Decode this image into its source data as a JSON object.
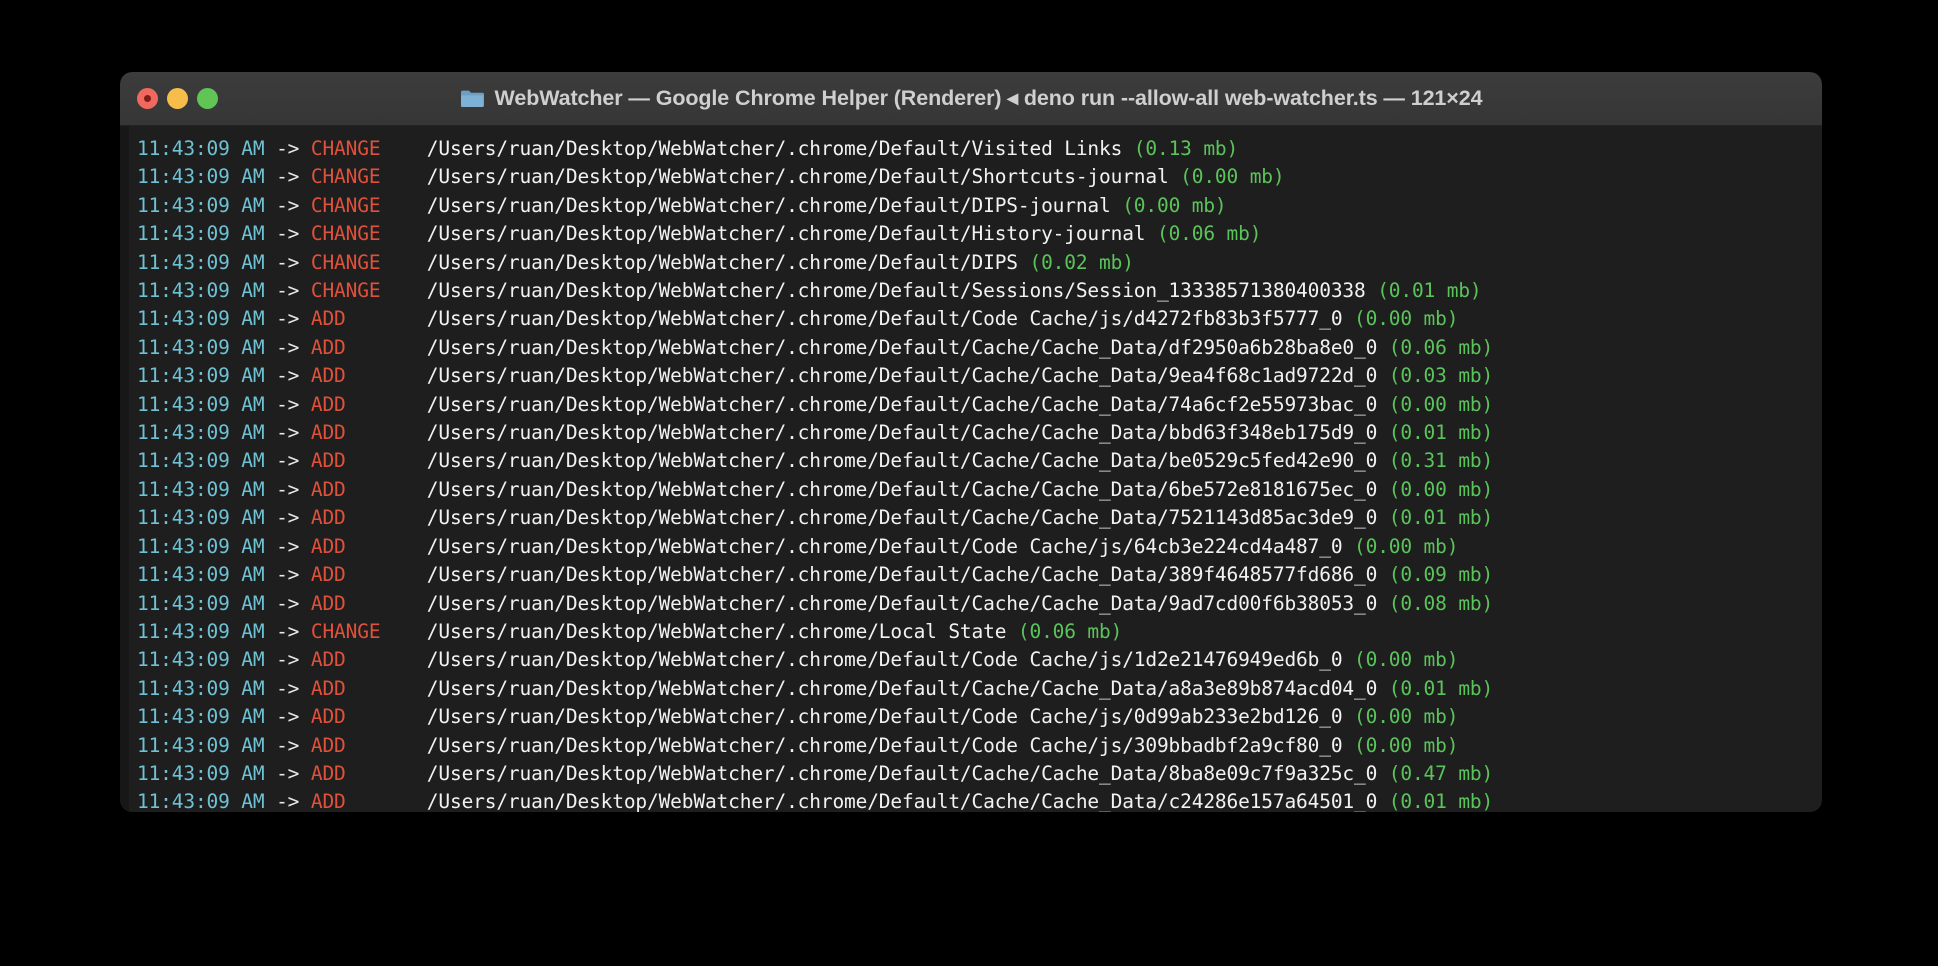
{
  "window": {
    "title": "WebWatcher — Google Chrome Helper (Renderer) ◂ deno run --allow-all web-watcher.ts — 121×24",
    "folder_icon": "folder-icon",
    "traffic_lights": {
      "close_label": "close",
      "minimize_label": "minimize",
      "maximize_label": "maximize",
      "close_color": "#f0685f",
      "minimize_color": "#f7bd4b",
      "maximize_color": "#61c555"
    }
  },
  "theme": {
    "background": "#000000",
    "titlebar": "#3a3a3a",
    "terminal_background": "#1e1e1e",
    "time_color": "#6ec2d4",
    "event_color": "#e0513b",
    "path_color": "#f2f2f2",
    "size_color": "#5ac45a",
    "arrow_color": "#e8e8e8"
  },
  "terminal": {
    "arrow": "->",
    "columns": 121,
    "rows": 24,
    "lines": [
      {
        "time": "11:43:09 AM",
        "event": "CHANGE",
        "path": "/Users/ruan/Desktop/WebWatcher/.chrome/Default/Visited Links",
        "size": "(0.13 mb)"
      },
      {
        "time": "11:43:09 AM",
        "event": "CHANGE",
        "path": "/Users/ruan/Desktop/WebWatcher/.chrome/Default/Shortcuts-journal",
        "size": "(0.00 mb)"
      },
      {
        "time": "11:43:09 AM",
        "event": "CHANGE",
        "path": "/Users/ruan/Desktop/WebWatcher/.chrome/Default/DIPS-journal",
        "size": "(0.00 mb)"
      },
      {
        "time": "11:43:09 AM",
        "event": "CHANGE",
        "path": "/Users/ruan/Desktop/WebWatcher/.chrome/Default/History-journal",
        "size": "(0.06 mb)"
      },
      {
        "time": "11:43:09 AM",
        "event": "CHANGE",
        "path": "/Users/ruan/Desktop/WebWatcher/.chrome/Default/DIPS",
        "size": "(0.02 mb)"
      },
      {
        "time": "11:43:09 AM",
        "event": "CHANGE",
        "path": "/Users/ruan/Desktop/WebWatcher/.chrome/Default/Sessions/Session_13338571380400338",
        "size": "(0.01 mb)"
      },
      {
        "time": "11:43:09 AM",
        "event": "ADD",
        "path": "/Users/ruan/Desktop/WebWatcher/.chrome/Default/Code Cache/js/d4272fb83b3f5777_0",
        "size": "(0.00 mb)"
      },
      {
        "time": "11:43:09 AM",
        "event": "ADD",
        "path": "/Users/ruan/Desktop/WebWatcher/.chrome/Default/Cache/Cache_Data/df2950a6b28ba8e0_0",
        "size": "(0.06 mb)"
      },
      {
        "time": "11:43:09 AM",
        "event": "ADD",
        "path": "/Users/ruan/Desktop/WebWatcher/.chrome/Default/Cache/Cache_Data/9ea4f68c1ad9722d_0",
        "size": "(0.03 mb)"
      },
      {
        "time": "11:43:09 AM",
        "event": "ADD",
        "path": "/Users/ruan/Desktop/WebWatcher/.chrome/Default/Cache/Cache_Data/74a6cf2e55973bac_0",
        "size": "(0.00 mb)"
      },
      {
        "time": "11:43:09 AM",
        "event": "ADD",
        "path": "/Users/ruan/Desktop/WebWatcher/.chrome/Default/Cache/Cache_Data/bbd63f348eb175d9_0",
        "size": "(0.01 mb)"
      },
      {
        "time": "11:43:09 AM",
        "event": "ADD",
        "path": "/Users/ruan/Desktop/WebWatcher/.chrome/Default/Cache/Cache_Data/be0529c5fed42e90_0",
        "size": "(0.31 mb)"
      },
      {
        "time": "11:43:09 AM",
        "event": "ADD",
        "path": "/Users/ruan/Desktop/WebWatcher/.chrome/Default/Cache/Cache_Data/6be572e8181675ec_0",
        "size": "(0.00 mb)"
      },
      {
        "time": "11:43:09 AM",
        "event": "ADD",
        "path": "/Users/ruan/Desktop/WebWatcher/.chrome/Default/Cache/Cache_Data/7521143d85ac3de9_0",
        "size": "(0.01 mb)"
      },
      {
        "time": "11:43:09 AM",
        "event": "ADD",
        "path": "/Users/ruan/Desktop/WebWatcher/.chrome/Default/Code Cache/js/64cb3e224cd4a487_0",
        "size": "(0.00 mb)"
      },
      {
        "time": "11:43:09 AM",
        "event": "ADD",
        "path": "/Users/ruan/Desktop/WebWatcher/.chrome/Default/Cache/Cache_Data/389f4648577fd686_0",
        "size": "(0.09 mb)"
      },
      {
        "time": "11:43:09 AM",
        "event": "ADD",
        "path": "/Users/ruan/Desktop/WebWatcher/.chrome/Default/Cache/Cache_Data/9ad7cd00f6b38053_0",
        "size": "(0.08 mb)"
      },
      {
        "time": "11:43:09 AM",
        "event": "CHANGE",
        "path": "/Users/ruan/Desktop/WebWatcher/.chrome/Local State",
        "size": "(0.06 mb)"
      },
      {
        "time": "11:43:09 AM",
        "event": "ADD",
        "path": "/Users/ruan/Desktop/WebWatcher/.chrome/Default/Code Cache/js/1d2e21476949ed6b_0",
        "size": "(0.00 mb)"
      },
      {
        "time": "11:43:09 AM",
        "event": "ADD",
        "path": "/Users/ruan/Desktop/WebWatcher/.chrome/Default/Cache/Cache_Data/a8a3e89b874acd04_0",
        "size": "(0.01 mb)"
      },
      {
        "time": "11:43:09 AM",
        "event": "ADD",
        "path": "/Users/ruan/Desktop/WebWatcher/.chrome/Default/Code Cache/js/0d99ab233e2bd126_0",
        "size": "(0.00 mb)"
      },
      {
        "time": "11:43:09 AM",
        "event": "ADD",
        "path": "/Users/ruan/Desktop/WebWatcher/.chrome/Default/Code Cache/js/309bbadbf2a9cf80_0",
        "size": "(0.00 mb)"
      },
      {
        "time": "11:43:09 AM",
        "event": "ADD",
        "path": "/Users/ruan/Desktop/WebWatcher/.chrome/Default/Cache/Cache_Data/8ba8e09c7f9a325c_0",
        "size": "(0.47 mb)"
      },
      {
        "time": "11:43:09 AM",
        "event": "ADD",
        "path": "/Users/ruan/Desktop/WebWatcher/.chrome/Default/Cache/Cache_Data/c24286e157a64501_0",
        "size": "(0.01 mb)"
      }
    ]
  }
}
